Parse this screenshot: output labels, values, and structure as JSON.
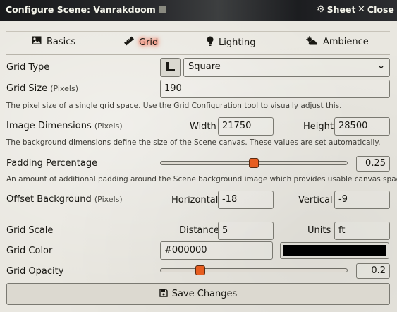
{
  "header": {
    "title": "Configure Scene: Vanrakdoom",
    "sheet_label": "Sheet",
    "close_label": "Close"
  },
  "tabs": [
    {
      "label": "Basics",
      "icon": "image-icon"
    },
    {
      "label": "Grid",
      "icon": "ruler-icon",
      "active": true
    },
    {
      "label": "Lighting",
      "icon": "lightbulb-icon"
    },
    {
      "label": "Ambience",
      "icon": "cloud-sun-icon"
    }
  ],
  "grid_type": {
    "label": "Grid Type",
    "value": "Square"
  },
  "grid_size": {
    "label": "Grid Size",
    "units": "(Pixels)",
    "value": "190",
    "hint": "The pixel size of a single grid space. Use the Grid Configuration tool to visually adjust this."
  },
  "image_dimensions": {
    "label": "Image Dimensions",
    "units": "(Pixels)",
    "width_label": "Width",
    "width": "21750",
    "height_label": "Height",
    "height": "28500",
    "hint": "The background dimensions define the size of the Scene canvas. These values are set automatically."
  },
  "padding": {
    "label": "Padding Percentage",
    "value": "0.25",
    "fraction": 0.5,
    "hint": "An amount of additional padding around the Scene background image which provides usable canvas space."
  },
  "offset": {
    "label": "Offset Background",
    "units": "(Pixels)",
    "horizontal_label": "Horizontal",
    "horizontal": "-18",
    "vertical_label": "Vertical",
    "vertical": "-9"
  },
  "grid_scale": {
    "label": "Grid Scale",
    "distance_label": "Distance",
    "distance": "5",
    "units_label": "Units",
    "units": "ft"
  },
  "grid_color": {
    "label": "Grid Color",
    "value": "#000000"
  },
  "grid_opacity": {
    "label": "Grid Opacity",
    "value": "0.2",
    "fraction": 0.2
  },
  "save_label": "Save Changes",
  "colors": {
    "accent": "#e65d20",
    "header_bg": "#1f2023"
  }
}
